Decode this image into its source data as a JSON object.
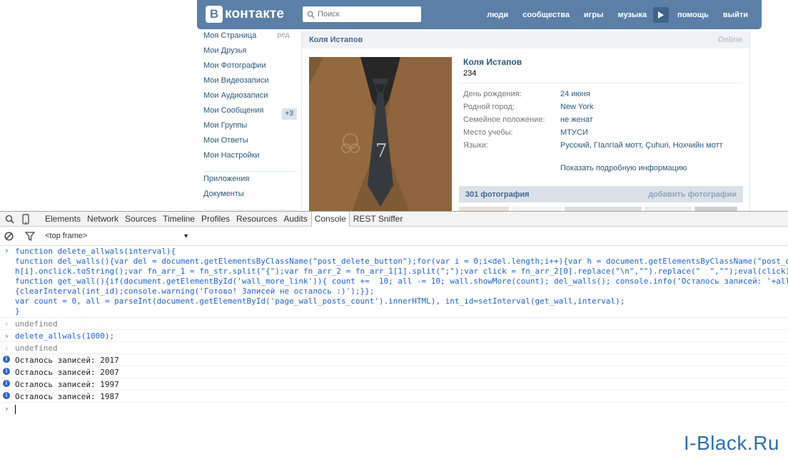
{
  "vk": {
    "logo_letter": "В",
    "logo_text": "контакте",
    "search_placeholder": "Поиск",
    "nav": [
      "люди",
      "сообщества",
      "игры",
      "музыка",
      "помощь",
      "выйти"
    ],
    "sidebar": {
      "items": [
        {
          "label": "Моя Страница",
          "extra": "ред."
        },
        {
          "label": "Мои Друзья"
        },
        {
          "label": "Мои Фотографии"
        },
        {
          "label": "Мои Видеозаписи"
        },
        {
          "label": "Мои Аудиозаписи"
        },
        {
          "label": "Мои Сообщения",
          "badge": "+3"
        },
        {
          "label": "Мои Группы"
        },
        {
          "label": "Мои Ответы"
        },
        {
          "label": "Мои Настройки"
        }
      ],
      "apps": [
        "Приложения",
        "Документы"
      ]
    },
    "profile": {
      "head_name": "Коля Истапов",
      "online": "Online",
      "name": "Коля Истапов",
      "status": "234",
      "info": [
        {
          "k": "День рождения:",
          "v": "24 июня"
        },
        {
          "k": "Родной город:",
          "v": "New York"
        },
        {
          "k": "Семейное положение:",
          "v": "не женат"
        },
        {
          "k": "Место учебы:",
          "v": "МТУСИ"
        },
        {
          "k": "Языки:",
          "v": "Русский, ГӀалгӀай мотт, Çuhuri, Нохчийн мотт"
        }
      ],
      "more": "Показать подробную информацию",
      "photos_count": "301 фотография",
      "add_photos": "добавить фотографии"
    }
  },
  "devtools": {
    "tabs": [
      "Elements",
      "Network",
      "Sources",
      "Timeline",
      "Profiles",
      "Resources",
      "Audits",
      "Console",
      "REST Sniffer"
    ],
    "active_tab": "Console",
    "frame": "<top frame>",
    "console": [
      {
        "kind": "input",
        "lines": [
          "function delete_allwals(interval){",
          "function del_walls(){var del = document.getElementsByClassName(\"post_delete_button\");for(var i = 0;i<del.length;i++){var h = document.getElementsByClassName(\"post_d",
          "h[i].onclick.toString();var fn_arr_1 = fn_str.split(\"{\");var fn_arr_2 = fn_arr_1[1].split(\";\");var click = fn_arr_2[0].replace(\"\\n\",\"\").replace(\"  \",\"\");eval(click)",
          "function get_wall(){if(document.getElementById('wall_more_link')){ count +=  10; all -= 10; wall.showMore(count); del_walls(); console.info('Осталось записей: '+all",
          "{clearInterval(int_id);console.warning('Готово! Записей не осталось :)');}};",
          "var count = 0, all = parseInt(document.getElementById('page_wall_posts_count').innerHTML), int_id=setInterval(get_wall,interval);",
          "}"
        ]
      },
      {
        "kind": "result",
        "lines": [
          "undefined"
        ]
      },
      {
        "kind": "input",
        "lines": [
          "delete_allwals(1000);"
        ]
      },
      {
        "kind": "result",
        "lines": [
          "undefined"
        ]
      },
      {
        "kind": "info",
        "lines": [
          "Осталось записей: 2017"
        ]
      },
      {
        "kind": "info",
        "lines": [
          "Осталось записей: 2007"
        ]
      },
      {
        "kind": "info",
        "lines": [
          "Осталось записей: 1997"
        ]
      },
      {
        "kind": "info",
        "lines": [
          "Осталось записей: 1987"
        ]
      }
    ]
  },
  "watermark": "I-Black.Ru"
}
